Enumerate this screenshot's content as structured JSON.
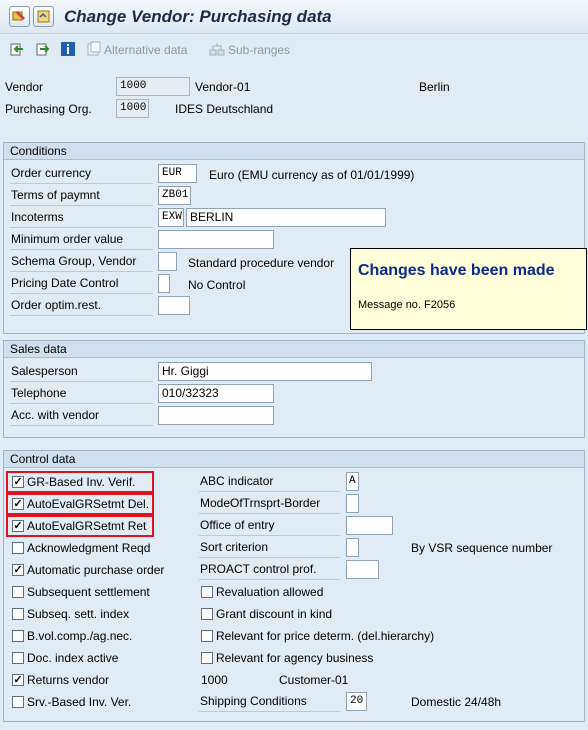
{
  "window": {
    "title": "Change Vendor: Purchasing data"
  },
  "toolbar": {
    "alternative_data_label": "Alternative data",
    "sub_ranges_label": "Sub-ranges"
  },
  "header": {
    "vendor_label": "Vendor",
    "vendor_value": "1000",
    "vendor_name": "Vendor-01",
    "vendor_city": "Berlin",
    "purch_org_label": "Purchasing Org.",
    "purch_org_value": "1000",
    "purch_org_name": "IDES Deutschland"
  },
  "conditions": {
    "title": "Conditions",
    "order_currency_label": "Order currency",
    "order_currency_value": "EUR",
    "order_currency_desc": "Euro (EMU currency as of 01/01/1999)",
    "terms_label": "Terms of paymnt",
    "terms_value": "ZB01",
    "incoterms_label": "Incoterms",
    "incoterms_value1": "EXW",
    "incoterms_value2": "BERLIN",
    "min_order_label": "Minimum order value",
    "min_order_value": "",
    "schema_label": "Schema Group, Vendor",
    "schema_value": "",
    "schema_desc": "Standard procedure vendor",
    "pricing_label": "Pricing Date Control",
    "pricing_value": "",
    "pricing_desc": "No Control",
    "optim_label": "Order optim.rest.",
    "optim_value": ""
  },
  "message": {
    "title": "Changes have been made",
    "number": "Message no. F2056"
  },
  "sales": {
    "title": "Sales data",
    "salesperson_label": "Salesperson",
    "salesperson_value": "Hr. Giggi",
    "telephone_label": "Telephone",
    "telephone_value": "010/32323",
    "acc_label": "Acc. with vendor",
    "acc_value": ""
  },
  "control": {
    "title": "Control data",
    "gr_based": {
      "label": "GR-Based Inv. Verif.",
      "checked": true
    },
    "auto_eval_del": {
      "label": "AutoEvalGRSetmt Del.",
      "checked": true
    },
    "auto_eval_ret": {
      "label": "AutoEvalGRSetmt Ret",
      "checked": true
    },
    "ack_reqd": {
      "label": "Acknowledgment Reqd",
      "checked": false
    },
    "auto_po": {
      "label": "Automatic purchase order",
      "checked": true
    },
    "subseq_settle": {
      "label": "Subsequent settlement",
      "checked": false
    },
    "subseq_index": {
      "label": "Subseq. sett. index",
      "checked": false
    },
    "bvol": {
      "label": "B.vol.comp./ag.nec.",
      "checked": false
    },
    "doc_index": {
      "label": "Doc. index active",
      "checked": false
    },
    "returns_vendor": {
      "label": "Returns vendor",
      "checked": true
    },
    "returns_vendor_value": "1000",
    "returns_vendor_name": "Customer-01",
    "srv_based": {
      "label": "Srv.-Based Inv. Ver.",
      "checked": false
    },
    "abc_label": "ABC indicator",
    "abc_value": "A",
    "mode_label": "ModeOfTrnsprt-Border",
    "mode_value": "",
    "office_label": "Office of entry",
    "office_value": "",
    "sort_label": "Sort criterion",
    "sort_value": "",
    "sort_desc": "By VSR sequence number",
    "proact_label": "PROACT control prof.",
    "proact_value": "",
    "reval": {
      "label": "Revaluation allowed",
      "checked": false
    },
    "grant": {
      "label": "Grant discount in kind",
      "checked": false
    },
    "relevant_price": {
      "label": "Relevant for price determ. (del.hierarchy)",
      "checked": false
    },
    "relevant_agency": {
      "label": "Relevant for agency business",
      "checked": false
    },
    "shipping_label": "Shipping Conditions",
    "shipping_value": "20",
    "shipping_desc": "Domestic 24/48h"
  }
}
